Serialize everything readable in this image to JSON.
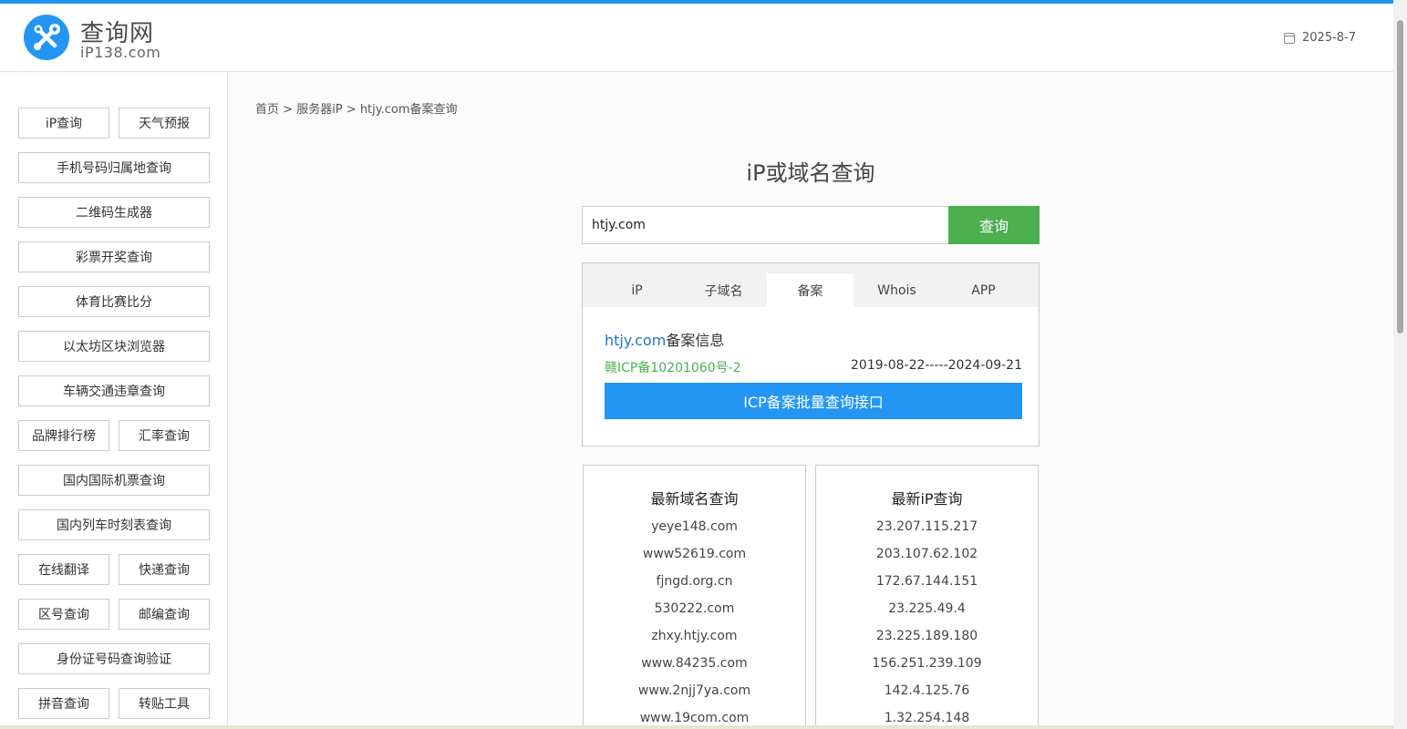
{
  "header": {
    "logo_title": "查询网",
    "logo_sub": "iP138.com",
    "date": "2025-8-7"
  },
  "sidebar": {
    "items": [
      {
        "label": "iP查询"
      },
      {
        "label": "天气预报"
      },
      {
        "label": "手机号码归属地查询"
      },
      {
        "label": "二维码生成器"
      },
      {
        "label": "彩票开奖查询"
      },
      {
        "label": "体育比赛比分"
      },
      {
        "label": "以太坊区块浏览器"
      },
      {
        "label": "车辆交通违章查询"
      },
      {
        "label": "品牌排行榜"
      },
      {
        "label": "汇率查询"
      },
      {
        "label": "国内国际机票查询"
      },
      {
        "label": "国内列车时刻表查询"
      },
      {
        "label": "在线翻译"
      },
      {
        "label": "快递查询"
      },
      {
        "label": "区号查询"
      },
      {
        "label": "邮编查询"
      },
      {
        "label": "身份证号码查询验证"
      },
      {
        "label": "拼音查询"
      },
      {
        "label": "转贴工具"
      }
    ]
  },
  "breadcrumb": {
    "home": "首页",
    "sep1": " > ",
    "section": "服务器iP",
    "sep2": " > ",
    "current": "htjy.com备案查询"
  },
  "main": {
    "title": "iP或域名查询",
    "search_value": "htjy.com",
    "search_button": "查询",
    "tabs": [
      {
        "label": "iP"
      },
      {
        "label": "子域名"
      },
      {
        "label": "备案"
      },
      {
        "label": "Whois"
      },
      {
        "label": "APP"
      }
    ],
    "active_tab": "备案",
    "result": {
      "domain": "htjy.com",
      "title_suffix": "备案信息",
      "icp_number": "赣ICP备10201060号-2",
      "date_range": "2019-08-22-----2024-09-21",
      "batch_button": "ICP备案批量查询接口"
    }
  },
  "latest_domains": {
    "title": "最新域名查询",
    "items": [
      "yeye148.com",
      "www52619.com",
      "fjngd.org.cn",
      "530222.com",
      "zhxy.htjy.com",
      "www.84235.com",
      "www.2njj7ya.com",
      "www.19com.com"
    ]
  },
  "latest_ips": {
    "title": "最新iP查询",
    "items": [
      "23.207.115.217",
      "203.107.62.102",
      "172.67.144.151",
      "23.225.49.4",
      "23.225.189.180",
      "156.251.239.109",
      "142.4.125.76",
      "1.32.254.148"
    ]
  },
  "colors": {
    "accent_blue": "#2396f3",
    "query_green": "#4caf50",
    "link_blue": "#1e78c8"
  },
  "icons": {
    "logo": "tools-wrench-icon",
    "date": "calendar-icon"
  }
}
